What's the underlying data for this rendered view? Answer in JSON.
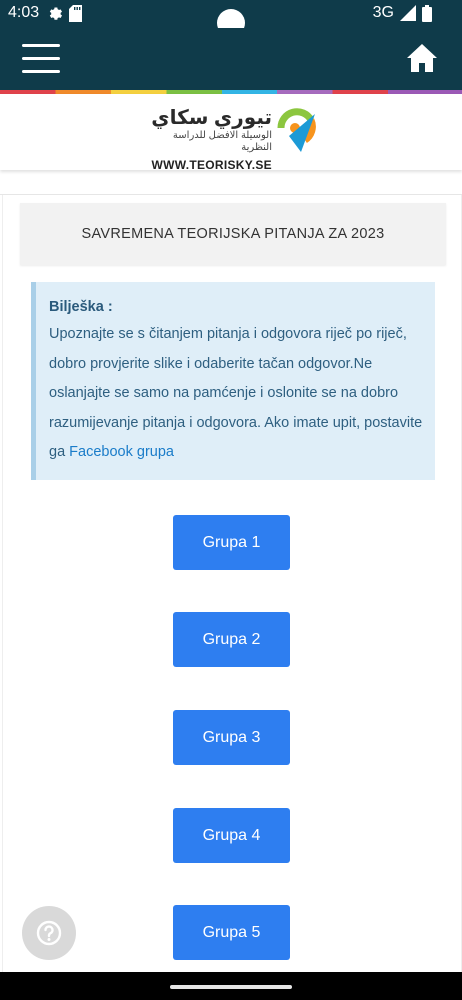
{
  "status_bar": {
    "time": "4:03",
    "network": "3G",
    "icons": [
      "gear-icon",
      "sd-card-icon",
      "signal-icon",
      "battery-icon"
    ]
  },
  "app_bar": {
    "menu_icon": "hamburger-menu-icon",
    "home_icon": "home-icon",
    "background_color": "#0f3b4a"
  },
  "logo": {
    "arabic_title": "تيوري سكاي",
    "arabic_subtitle": "الوسيلة الافضل للدراسة النظرية",
    "domain": "WWW.TEORISKY.SE"
  },
  "page": {
    "title": "SAVREMENA TEORIJSKA PITANJA ZA 2023"
  },
  "note": {
    "title": "Bilješka :",
    "body": "Upoznajte se s čitanjem pitanja i odgovora riječ po riječ, dobro provjerite slike i odaberite tačan odgovor.Ne oslanjajte se samo na pamćenje i oslonite se na dobro razumijevanje pitanja i odgovora. Ako imate upit, postavite ga ",
    "link_text": "Facebook grupa"
  },
  "groups": [
    {
      "label": "Grupa 1"
    },
    {
      "label": "Grupa 2"
    },
    {
      "label": "Grupa 3"
    },
    {
      "label": "Grupa 4"
    },
    {
      "label": "Grupa 5"
    }
  ],
  "colors": {
    "accent_button": "#2e7ef0",
    "note_background": "#dfeef8",
    "note_text": "#2e5f80",
    "link": "#1a7cc9"
  },
  "help_icon": "question-mark-icon"
}
